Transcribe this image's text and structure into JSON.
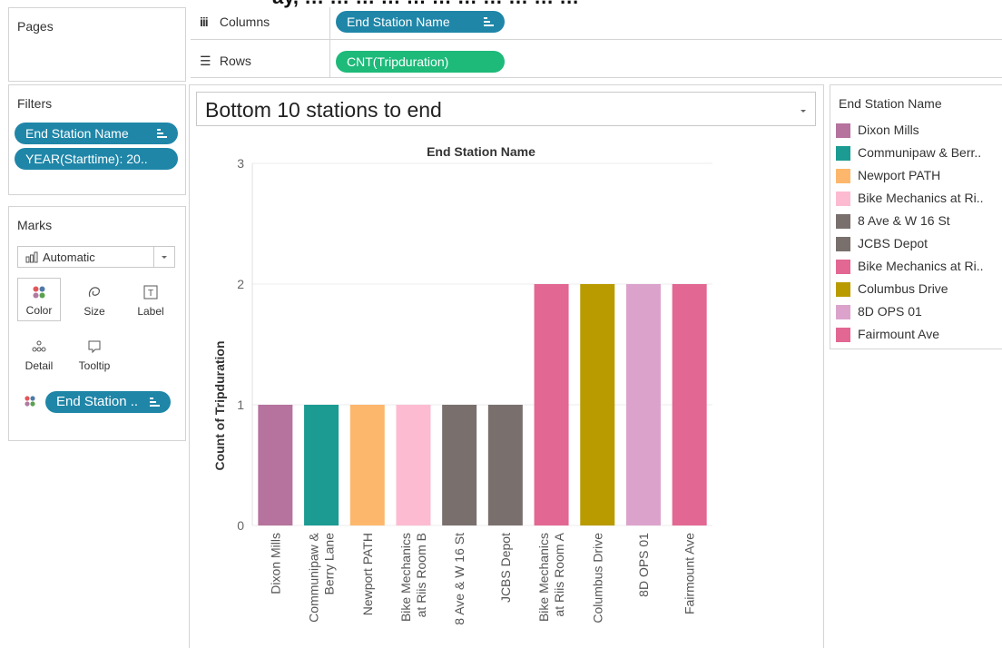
{
  "top_banner_text": "ay, … … … … … … … … … … …",
  "shelves": {
    "pages_label": "Pages",
    "columns_label": "Columns",
    "rows_label": "Rows",
    "columns_pill": "End Station Name",
    "rows_pill": "CNT(Tripduration)"
  },
  "filters": {
    "title": "Filters",
    "items": [
      {
        "label": "End Station Name"
      },
      {
        "label": "YEAR(Starttime): 20.."
      }
    ]
  },
  "marks": {
    "title": "Marks",
    "mark_type": "Automatic",
    "buttons": [
      {
        "label": "Color",
        "icon": "color-dots-icon"
      },
      {
        "label": "Size",
        "icon": "size-icon"
      },
      {
        "label": "Label",
        "icon": "label-icon"
      },
      {
        "label": "Detail",
        "icon": "detail-icon"
      },
      {
        "label": "Tooltip",
        "icon": "tooltip-icon"
      }
    ],
    "color_pill": "End Station .."
  },
  "worksheet": {
    "title": "Bottom 10 stations to end"
  },
  "legend": {
    "title": "End Station Name",
    "items": [
      {
        "label": "Dixon Mills",
        "color": "#b5739d"
      },
      {
        "label": "Communipaw & Berr..",
        "color": "#1b9b91"
      },
      {
        "label": "Newport PATH",
        "color": "#fcb76c"
      },
      {
        "label": "Bike Mechanics at Ri..",
        "color": "#fdbbd1"
      },
      {
        "label": "8 Ave & W 16 St",
        "color": "#79706e"
      },
      {
        "label": "JCBS Depot",
        "color": "#79706e"
      },
      {
        "label": "Bike Mechanics at Ri..",
        "color": "#e26792"
      },
      {
        "label": "Columbus Drive",
        "color": "#b99b00"
      },
      {
        "label": "8D OPS 01",
        "color": "#dba3cc"
      },
      {
        "label": "Fairmount Ave",
        "color": "#e26792"
      }
    ]
  },
  "chart_data": {
    "type": "bar",
    "title": "End Station Name",
    "xlabel": "",
    "ylabel": "Count of Tripduration",
    "ylim": [
      0,
      3
    ],
    "yticks": [
      0,
      1,
      2,
      3
    ],
    "grid": true,
    "categories": [
      [
        "Dixon Mills"
      ],
      [
        "Communipaw &",
        "Berry Lane"
      ],
      [
        "Newport PATH"
      ],
      [
        "Bike Mechanics",
        "at Riis Room B"
      ],
      [
        "8 Ave & W 16 St"
      ],
      [
        "JCBS Depot"
      ],
      [
        "Bike Mechanics",
        "at Riis Room A"
      ],
      [
        "Columbus Drive"
      ],
      [
        "8D OPS 01"
      ],
      [
        "Fairmount Ave"
      ]
    ],
    "values": [
      1,
      1,
      1,
      1,
      1,
      1,
      2,
      2,
      2,
      2
    ],
    "colors": [
      "#b5739d",
      "#1b9b91",
      "#fcb76c",
      "#fdbbd1",
      "#79706e",
      "#79706e",
      "#e26792",
      "#b99b00",
      "#dba3cc",
      "#e26792"
    ]
  }
}
